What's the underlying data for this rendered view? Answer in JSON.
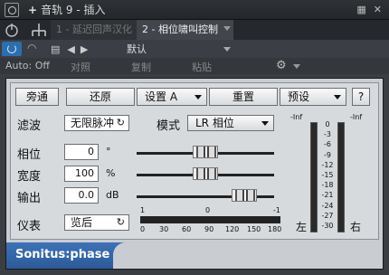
{
  "window": {
    "title": "音轨 9 - 插入"
  },
  "tabs": [
    {
      "label": "1 - 延迟回声汉化"
    },
    {
      "label": "2 - 相位啸叫控制"
    }
  ],
  "preset": {
    "name": "默认"
  },
  "automation": {
    "status": "Auto: Off",
    "actions": [
      "对照",
      "复制",
      "粘贴"
    ]
  },
  "plugin": {
    "buttons": {
      "bypass": "旁通",
      "restore": "还原",
      "setup": "设置 A",
      "reset": "重置",
      "presets": "预设",
      "help": "?"
    },
    "filter": {
      "label": "滤波",
      "value": "无限脉冲"
    },
    "mode": {
      "label": "模式",
      "value": "LR 相位"
    },
    "params": [
      {
        "label": "相位",
        "value": "0",
        "unit": "°",
        "level": 0.5
      },
      {
        "label": "宽度",
        "value": "100",
        "unit": "%",
        "level": 0.5
      },
      {
        "label": "输出",
        "value": "0.0",
        "unit": "dB",
        "level": 0.85
      }
    ],
    "meter": {
      "label": "仪表",
      "value": "览后",
      "scale_top": [
        "1",
        "0",
        "-1"
      ],
      "scale_bottom": [
        "0",
        "30",
        "60",
        "90",
        "120",
        "150",
        "180"
      ]
    },
    "vu": {
      "peak_left": "-Inf",
      "peak_right": "-Inf",
      "scale": [
        "0",
        "-3",
        "-6",
        "-9",
        "-12",
        "-15",
        "-18",
        "-21",
        "-24",
        "-27",
        "-30"
      ],
      "left_label": "左",
      "right_label": "右"
    },
    "brand": "Sonitus:phase"
  }
}
